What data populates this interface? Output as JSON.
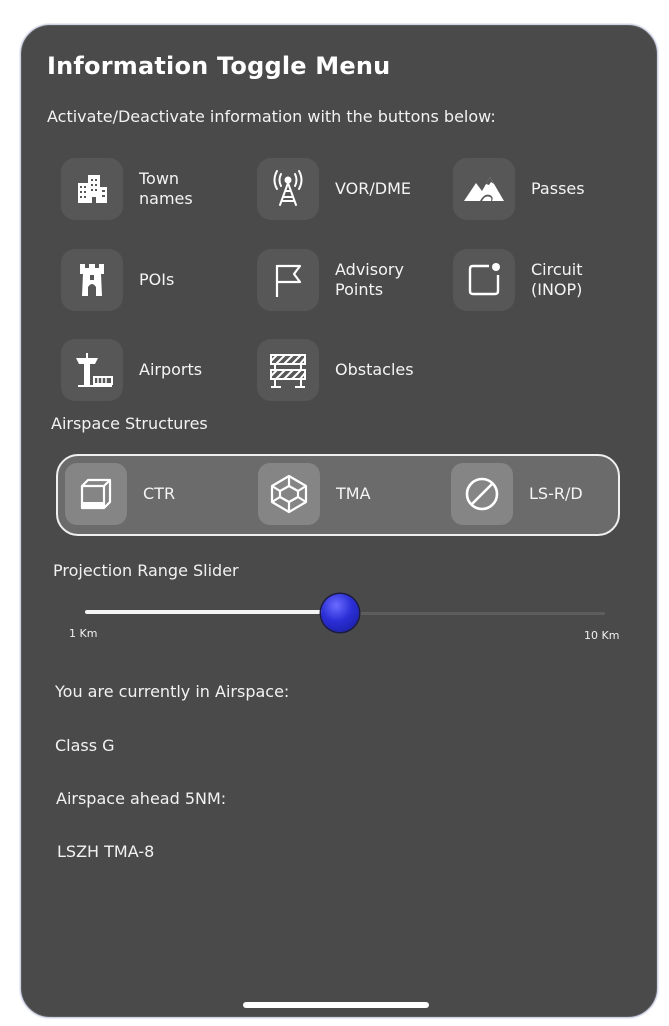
{
  "window": {
    "title": "Information Toggle Menu",
    "subtitle": "Activate/Deactivate information with the buttons below:"
  },
  "toggles": [
    {
      "label": "Town\nnames",
      "icon": "buildings-icon"
    },
    {
      "label": "VOR/DME",
      "icon": "radio-tower-icon"
    },
    {
      "label": "Passes",
      "icon": "mountains-icon"
    },
    {
      "label": "POIs",
      "icon": "castle-tower-icon"
    },
    {
      "label": "Advisory\nPoints",
      "icon": "flag-icon"
    },
    {
      "label": "Circuit\n(INOP)",
      "icon": "circuit-square-icon"
    },
    {
      "label": "Airports",
      "icon": "control-tower-icon"
    },
    {
      "label": "Obstacles",
      "icon": "barrier-icon"
    }
  ],
  "airspace": {
    "heading": "Airspace Structures",
    "items": [
      {
        "label": "CTR",
        "icon": "cube-icon"
      },
      {
        "label": "TMA",
        "icon": "wireframe-box-icon"
      },
      {
        "label": "LS-R/D",
        "icon": "prohibited-icon"
      }
    ]
  },
  "slider": {
    "heading": "Projection Range Slider",
    "min_label": "1 Km",
    "max_label": "10 Km",
    "value_fraction": 0.49,
    "knob_color": "#2b2fd6"
  },
  "status": {
    "current_heading": "You are currently in Airspace:",
    "current_value": "Class G",
    "ahead_heading": "Airspace ahead 5NM:",
    "ahead_value": "LSZH TMA-8"
  },
  "colors": {
    "panel": "#4a4a4a",
    "tile": "#575757",
    "airspace_box": "#6b6b6b"
  }
}
